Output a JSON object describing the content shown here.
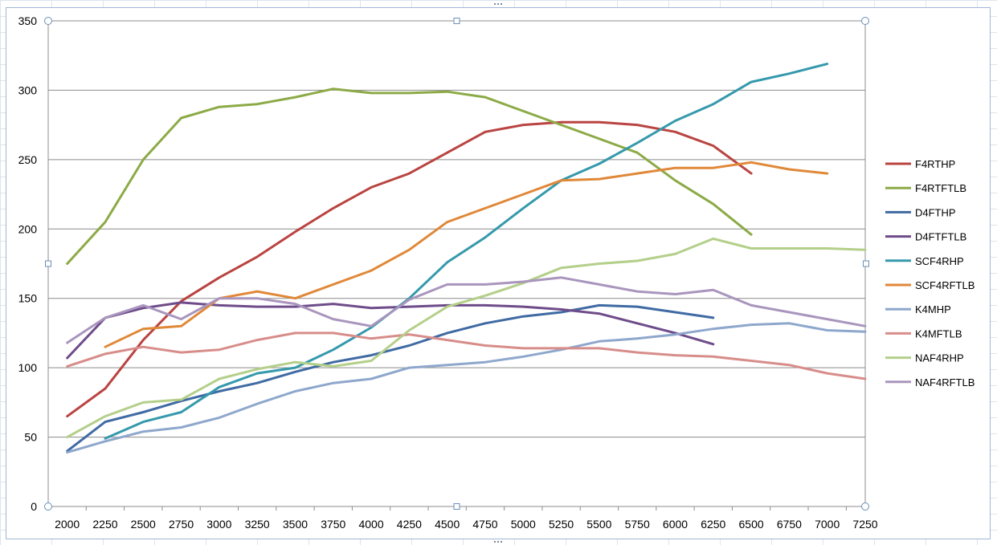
{
  "chart_data": {
    "type": "line",
    "title": "",
    "xlabel": "",
    "ylabel": "",
    "x": [
      2000,
      2250,
      2500,
      2750,
      3000,
      3250,
      3500,
      3750,
      4000,
      4250,
      4500,
      4750,
      5000,
      5250,
      5500,
      5750,
      6000,
      6250,
      6500,
      6750,
      7000,
      7250
    ],
    "x_tick_labels": [
      "2000",
      "2250",
      "2500",
      "2750",
      "3000",
      "3250",
      "3500",
      "3750",
      "4000",
      "4250",
      "4500",
      "4750",
      "5000",
      "5250",
      "5500",
      "5750",
      "6000",
      "6250",
      "6500",
      "6750",
      "7000",
      "7250"
    ],
    "ylim": [
      0,
      350
    ],
    "y_ticks": [
      0,
      50,
      100,
      150,
      200,
      250,
      300,
      350
    ],
    "y_tick_labels": [
      "0",
      "50",
      "100",
      "150",
      "200",
      "250",
      "300",
      "350"
    ],
    "grid": "horizontal",
    "legend_position": "right",
    "series": [
      {
        "name": "F4RTHP",
        "color": "#b94441",
        "values": [
          65,
          85,
          120,
          148,
          165,
          180,
          198,
          215,
          230,
          240,
          255,
          270,
          275,
          277,
          277,
          275,
          270,
          260,
          240,
          null,
          null,
          null
        ]
      },
      {
        "name": "F4RTFTLB",
        "color": "#8caa46",
        "values": [
          175,
          205,
          250,
          280,
          288,
          290,
          295,
          301,
          298,
          298,
          299,
          295,
          285,
          275,
          265,
          255,
          235,
          218,
          196,
          null,
          null,
          null
        ]
      },
      {
        "name": "D4FTHP",
        "color": "#3f6aa3",
        "values": [
          40,
          61,
          68,
          76,
          83,
          89,
          97,
          104,
          109,
          116,
          125,
          132,
          137,
          140,
          145,
          144,
          140,
          136,
          null,
          null,
          null,
          null
        ]
      },
      {
        "name": "D4FTFTLB",
        "color": "#6e4c8a",
        "values": [
          107,
          136,
          143,
          147,
          145,
          144,
          144,
          146,
          143,
          144,
          145,
          145,
          144,
          142,
          139,
          132,
          125,
          117,
          null,
          null,
          null,
          null
        ]
      },
      {
        "name": "SCF4RHP",
        "color": "#3599ac",
        "values": [
          null,
          49,
          61,
          68,
          86,
          96,
          100,
          113,
          129,
          150,
          176,
          194,
          215,
          235,
          247,
          262,
          278,
          290,
          306,
          312,
          319,
          null
        ]
      },
      {
        "name": "SCF4RFTLB",
        "color": "#e08838",
        "values": [
          null,
          115,
          128,
          130,
          150,
          155,
          150,
          160,
          170,
          185,
          205,
          215,
          225,
          235,
          236,
          240,
          244,
          244,
          248,
          243,
          240,
          null
        ]
      },
      {
        "name": "K4MHP",
        "color": "#8ea7cc",
        "values": [
          39,
          47,
          54,
          57,
          64,
          74,
          83,
          89,
          92,
          100,
          102,
          104,
          108,
          113,
          119,
          121,
          124,
          128,
          131,
          132,
          127,
          126
        ]
      },
      {
        "name": "K4MFTLB",
        "color": "#d78d8a",
        "values": [
          101,
          110,
          115,
          111,
          113,
          120,
          125,
          125,
          121,
          124,
          120,
          116,
          114,
          114,
          114,
          111,
          109,
          108,
          105,
          102,
          96,
          92
        ]
      },
      {
        "name": "NAF4RHP",
        "color": "#b4cf8a",
        "values": [
          50,
          65,
          75,
          77,
          92,
          99,
          104,
          101,
          105,
          127,
          144,
          152,
          161,
          172,
          175,
          177,
          182,
          193,
          186,
          186,
          186,
          185
        ]
      },
      {
        "name": "NAF4RFTLB",
        "color": "#a995bd",
        "values": [
          118,
          136,
          145,
          135,
          150,
          150,
          146,
          135,
          130,
          149,
          160,
          160,
          162,
          165,
          160,
          155,
          153,
          156,
          145,
          140,
          135,
          130
        ]
      }
    ]
  }
}
